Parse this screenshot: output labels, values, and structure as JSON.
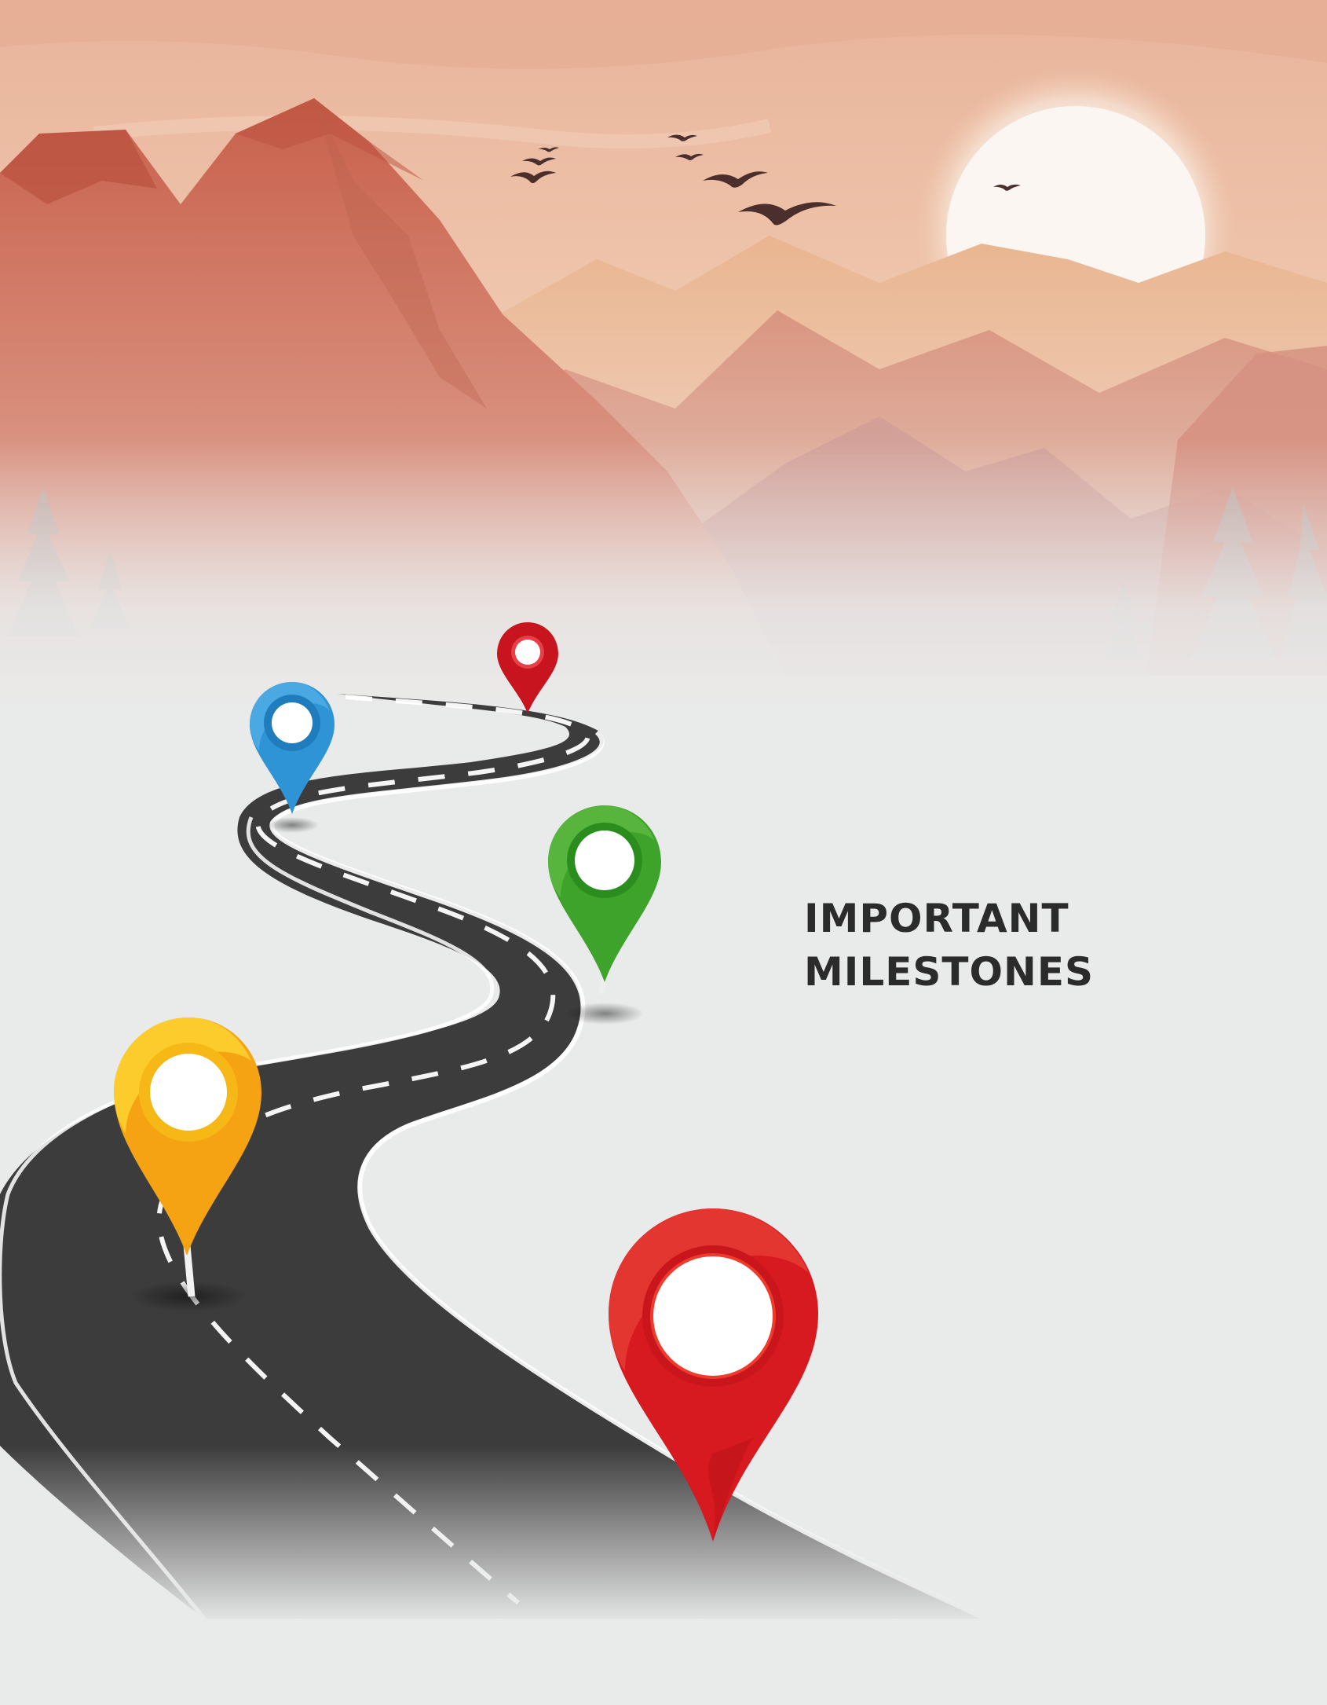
{
  "heading": {
    "line1": "IMPORTANT",
    "line2": "MILESTONES"
  },
  "colors": {
    "sky": "#ebbfa6",
    "sun": "#fbf6f1",
    "mountain_far": "#d9a28f",
    "mountain_near": "#cf7460",
    "ground": "#e9eaea",
    "road": "#3d3c3d",
    "road_line": "#ffffff",
    "text": "#2b2b2b"
  },
  "pins": [
    {
      "name": "red-small",
      "color": "#c8141e"
    },
    {
      "name": "blue",
      "color": "#2e94d6"
    },
    {
      "name": "green",
      "color": "#3ea32a"
    },
    {
      "name": "orange",
      "color": "#f5a313"
    },
    {
      "name": "red-large",
      "color": "#d71a1f"
    }
  ]
}
